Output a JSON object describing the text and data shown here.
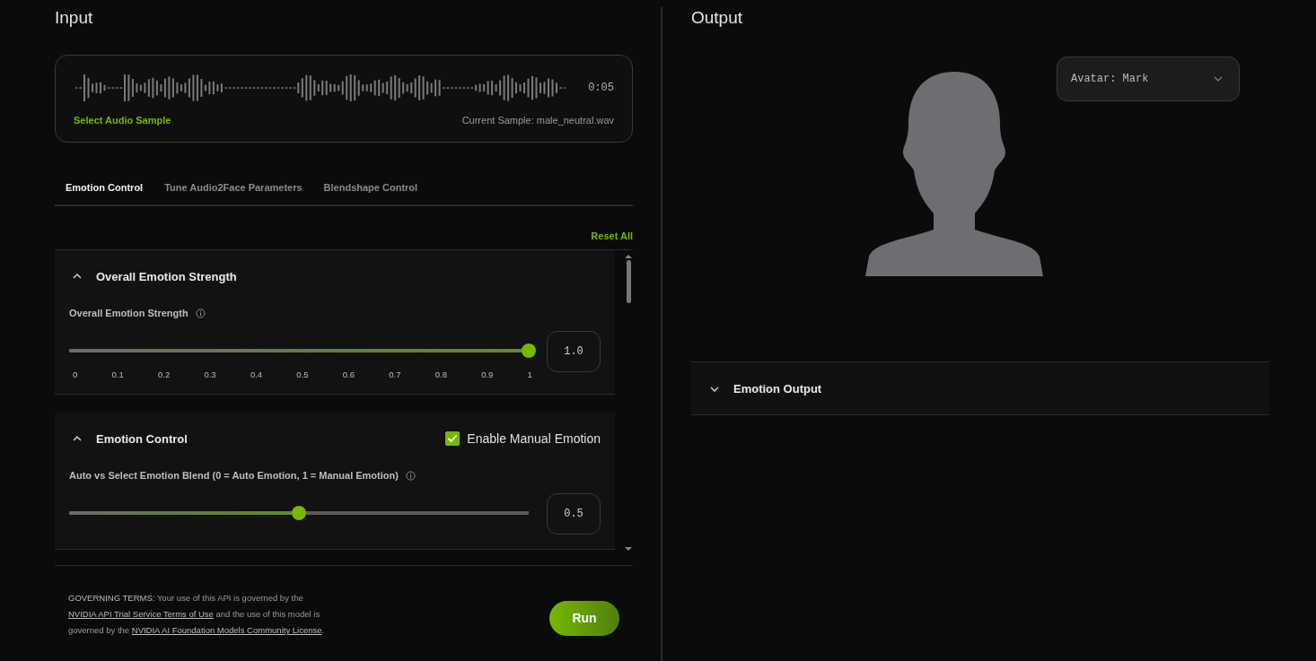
{
  "input": {
    "title": "Input",
    "audio": {
      "duration": "0:05",
      "select_link": "Select Audio Sample",
      "current_sample": "Current Sample: male_neutral.wav"
    },
    "tabs": [
      {
        "label": "Emotion Control",
        "selected": true
      },
      {
        "label": "Tune Audio2Face Parameters",
        "selected": false
      },
      {
        "label": "Blendshape Control",
        "selected": false
      }
    ],
    "reset_link": "Reset All",
    "sections": [
      {
        "title": "Overall Emotion Strength",
        "expanded": true,
        "sliders": [
          {
            "label": "Overall Emotion Strength",
            "level": 1,
            "value": "1.0",
            "ticks": [
              "0",
              "0.1",
              "0.2",
              "0.3",
              "0.4",
              "0.5",
              "0.6",
              "0.7",
              "0.8",
              "0.9",
              "1"
            ]
          }
        ]
      },
      {
        "title": "Emotion Control",
        "expanded": true,
        "checkbox": {
          "label": "Enable Manual Emotion",
          "checked": true
        },
        "sliders": [
          {
            "label": "Auto vs Select Emotion Blend (0 = Auto Emotion, 1 = Manual Emotion)",
            "level": 0.5,
            "value": "0.5"
          }
        ]
      }
    ],
    "terms": [
      {
        "kind": "bold",
        "text": "GOVERNING TERMS:"
      },
      {
        "kind": "text",
        "text": " Your use of this API is governed by the "
      },
      {
        "kind": "link",
        "text": "NVIDIA API Trial Service Terms of Use"
      },
      {
        "kind": "text",
        "text": " and the use of this model is governed by the "
      },
      {
        "kind": "link",
        "text": "NVIDIA AI Foundation Models Community License"
      },
      {
        "kind": "text",
        "text": "."
      }
    ],
    "run_button": "Run"
  },
  "output": {
    "title": "Output",
    "avatar_select": {
      "value": "Avatar: Mark"
    },
    "sections": [
      {
        "title": "Emotion Output",
        "expanded": false
      }
    ]
  }
}
